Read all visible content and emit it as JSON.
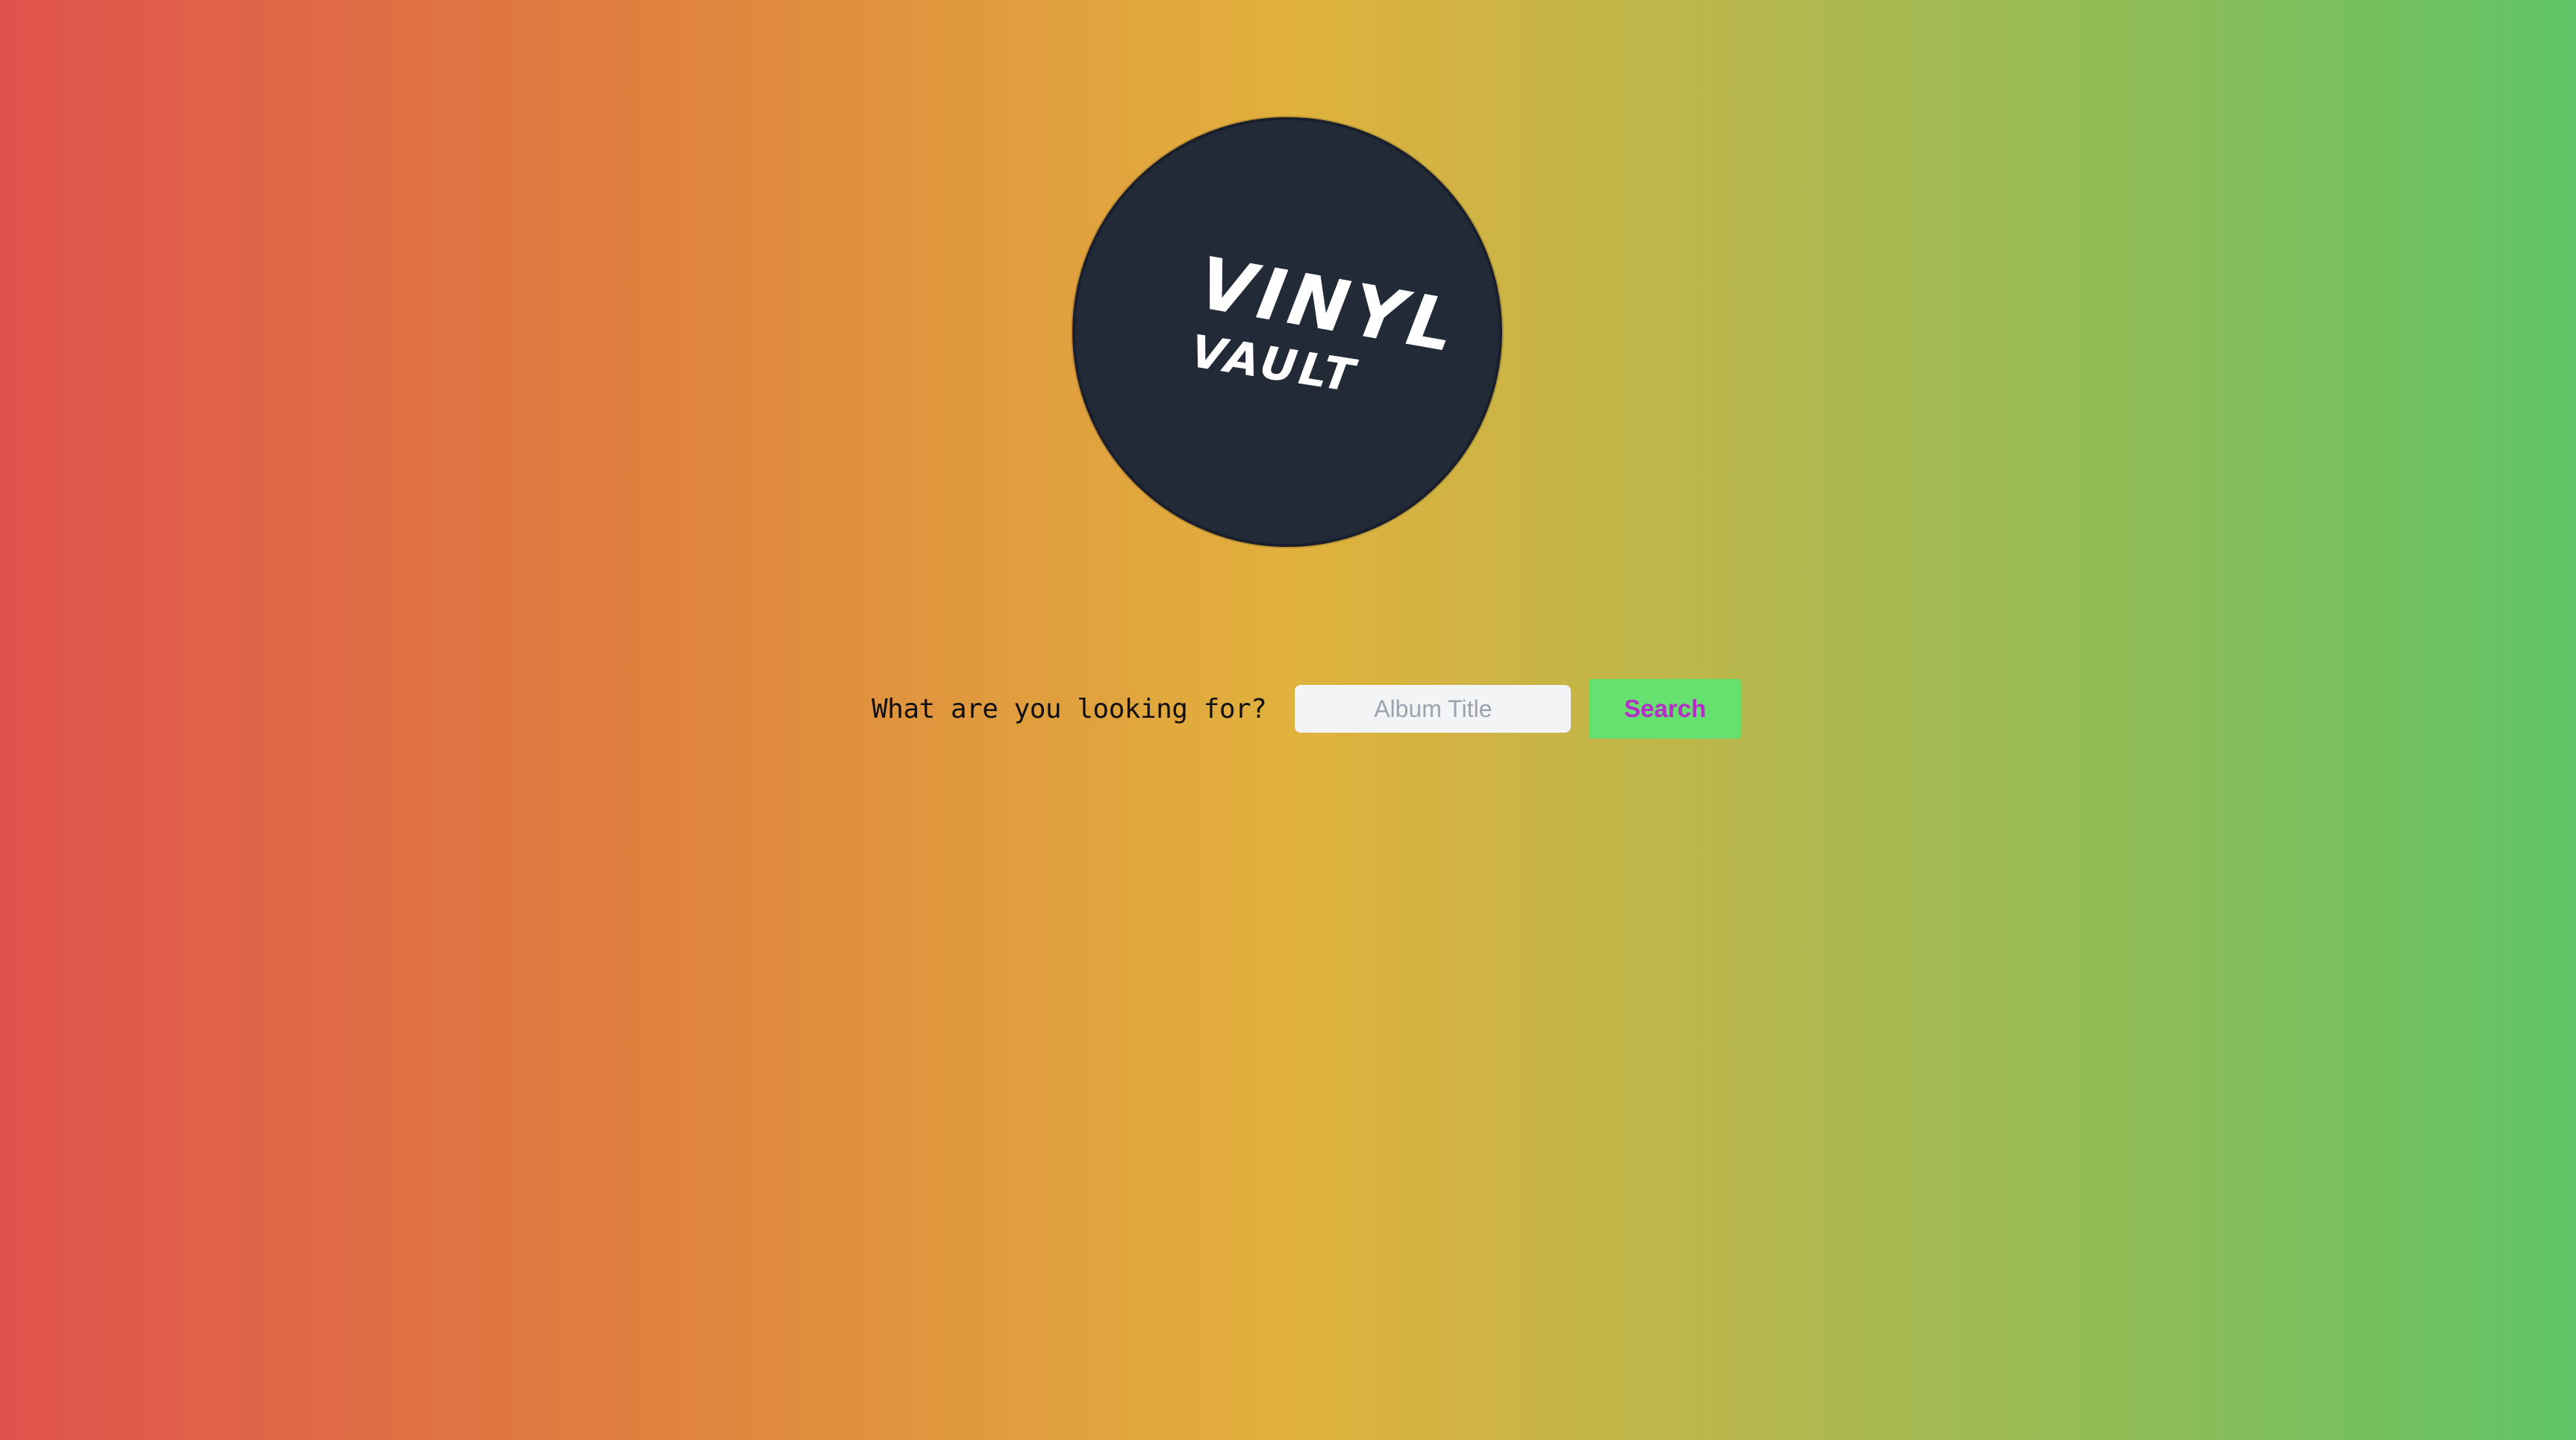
{
  "logo": {
    "line1": "VINYL",
    "line2": "VAULT"
  },
  "search": {
    "prompt": "What are you looking for?",
    "placeholder": "Album Title",
    "value": "",
    "button_label": "Search"
  },
  "colors": {
    "gradient_left": "#e0524d",
    "gradient_mid": "#e1b13d",
    "gradient_right": "#60c466",
    "logo_bg": "#222a38",
    "button_bg": "#66e06e",
    "button_text": "#b52cc7"
  }
}
